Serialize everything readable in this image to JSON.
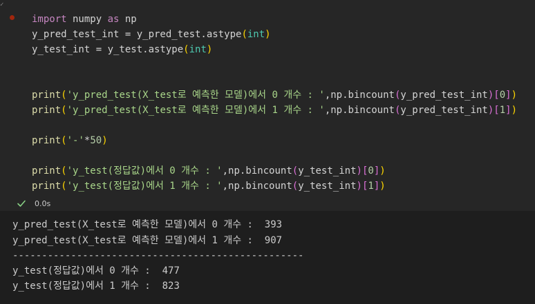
{
  "cell": {
    "code": {
      "line1": {
        "kw1": "import",
        "mod": " numpy ",
        "kw2": "as",
        "alias": " np"
      },
      "line2": {
        "lhs": "y_pred_test_int = y_pred_test.astype",
        "open": "(",
        "arg": "int",
        "close": ")"
      },
      "line3": {
        "lhs": "y_test_int = y_test.astype",
        "open": "(",
        "arg": "int",
        "close": ")"
      },
      "line4": {
        "fn": "print",
        "open": "(",
        "str": "'y_pred_test(X_test로 예측한 모델)에서 0 개수 : '",
        "mid": ",np.bincount",
        "open2": "(",
        "arg": "y_pred_test_int",
        "close2": ")",
        "idx_open": "[",
        "idx": "0",
        "idx_close": "]",
        "close": ")"
      },
      "line5": {
        "fn": "print",
        "open": "(",
        "str": "'y_pred_test(X_test로 예측한 모델)에서 1 개수 : '",
        "mid": ",np.bincount",
        "open2": "(",
        "arg": "y_pred_test_int",
        "close2": ")",
        "idx_open": "[",
        "idx": "1",
        "idx_close": "]",
        "close": ")"
      },
      "line6": {
        "fn": "print",
        "open": "(",
        "str": "'-'",
        "op": "*",
        "num": "50",
        "close": ")"
      },
      "line7": {
        "fn": "print",
        "open": "(",
        "str": "'y_test(정답값)에서 0 개수 : '",
        "mid": ",np.bincount",
        "open2": "(",
        "arg": "y_test_int",
        "close2": ")",
        "idx_open": "[",
        "idx": "0",
        "idx_close": "]",
        "close": ")"
      },
      "line8": {
        "fn": "print",
        "open": "(",
        "str": "'y_test(정답값)에서 1 개수 : '",
        "mid": ",np.bincount",
        "open2": "(",
        "arg": "y_test_int",
        "close2": ")",
        "idx_open": "[",
        "idx": "1",
        "idx_close": "]",
        "close": ")"
      }
    },
    "status": {
      "icon": "check-icon",
      "time": "0.0s"
    },
    "output": [
      "y_pred_test(X_test로 예측한 모델)에서 0 개수 :  393",
      "y_pred_test(X_test로 예측한 모델)에서 1 개수 :  907",
      "--------------------------------------------------",
      "y_test(정답값)에서 0 개수 :  477",
      "y_test(정답값)에서 1 개수 :  823"
    ]
  },
  "colors": {
    "code_bg": "#262626",
    "output_bg": "#1e1e1e",
    "success": "#89d185",
    "breakpoint": "#a1260d"
  }
}
